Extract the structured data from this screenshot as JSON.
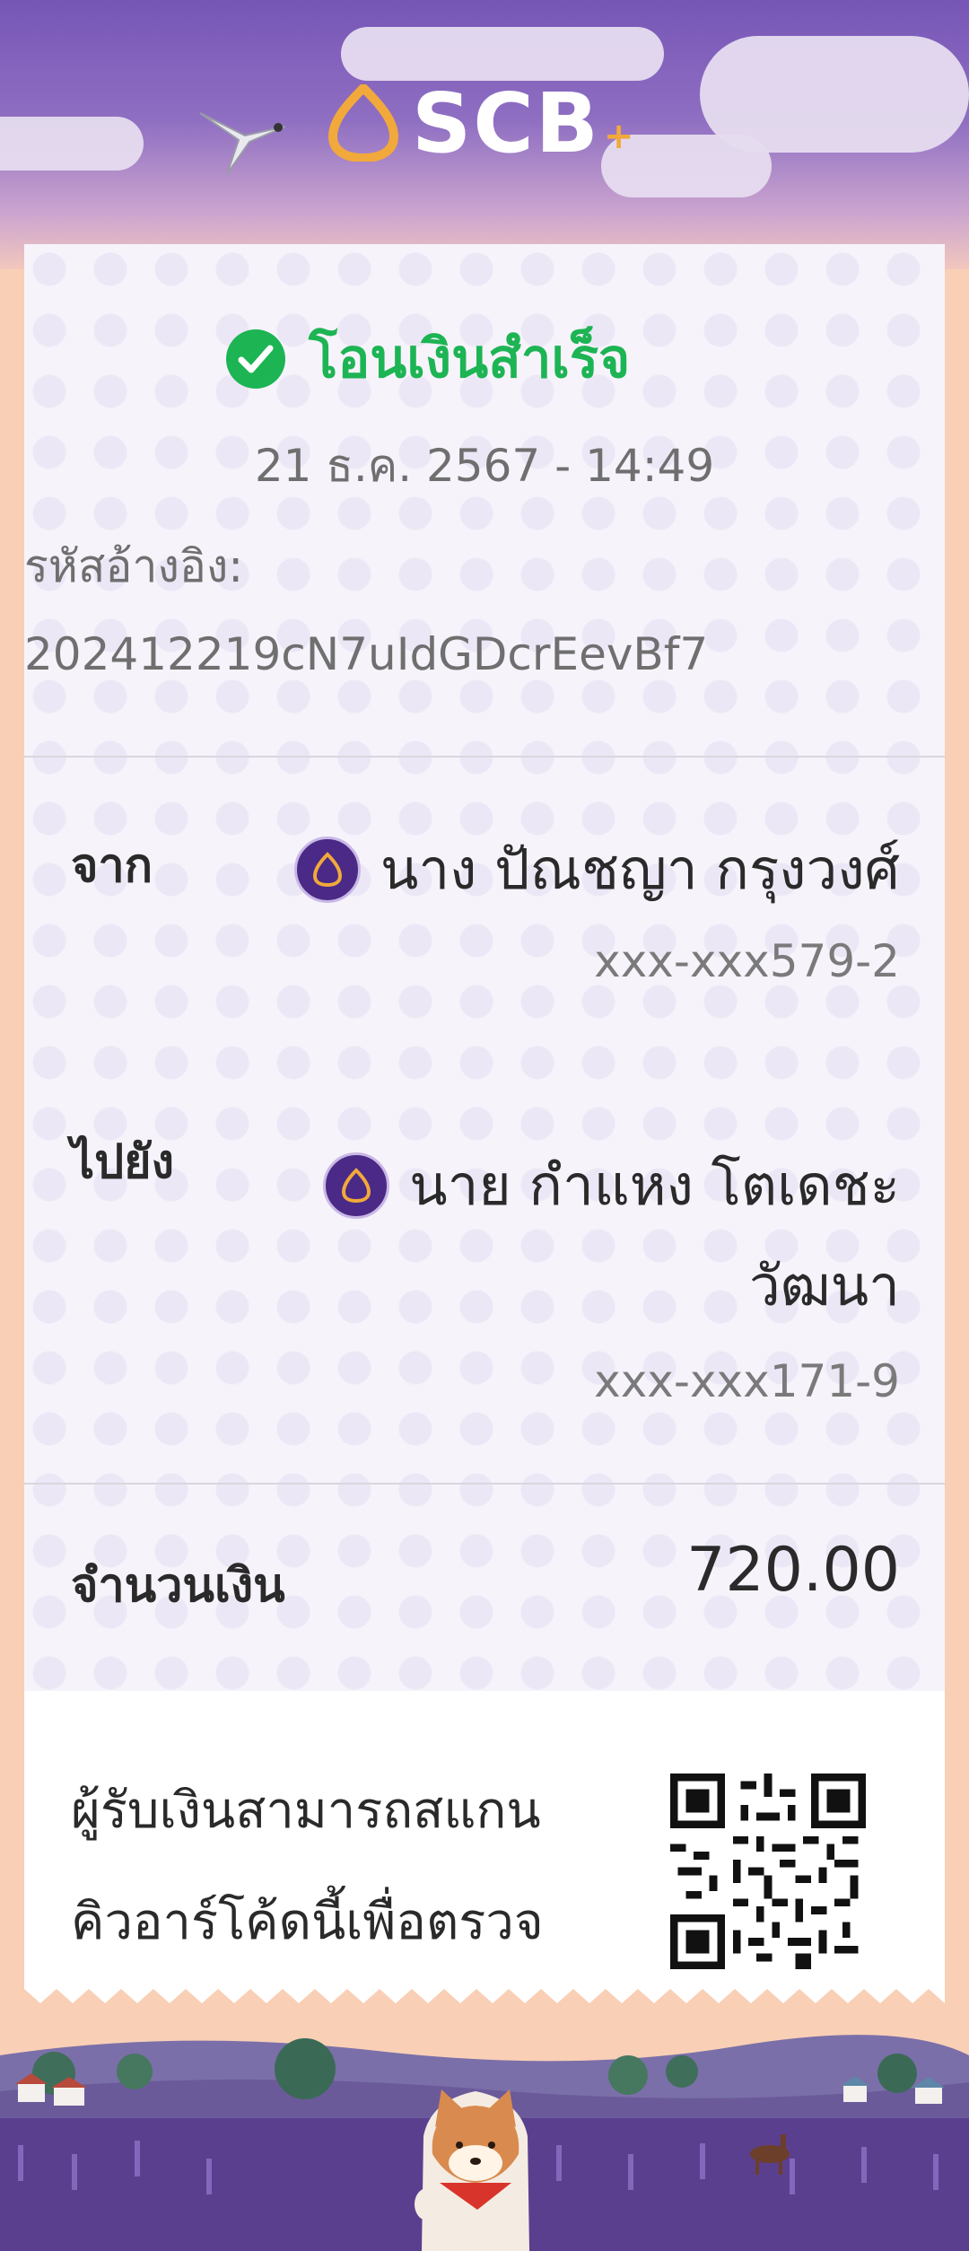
{
  "header": {
    "logo_text": "SCB",
    "logo_plus": "+"
  },
  "status": {
    "icon": "check-circle-icon",
    "text": "โอนเงินสำเร็จ",
    "color": "#1db454"
  },
  "transaction": {
    "datetime": "21 ธ.ค. 2567 - 14:49",
    "ref_label": "รหัสอ้างอิง:",
    "ref_value": "202412219cN7uIdGDcrEevBf7"
  },
  "from": {
    "label": "จาก",
    "name": "นาง ปัณชญา กรุงวงศ์",
    "account": "xxx-xxx579-2"
  },
  "to": {
    "label": "ไปยัง",
    "name_line1": "นาย กำแหง โตเดชะ",
    "name_line2": "วัฒนา",
    "account": "xxx-xxx171-9"
  },
  "amount": {
    "label": "จำนวนเงิน",
    "value": "720.00"
  },
  "qr_note": {
    "line1": "ผู้รับเงินสามารถสแกน",
    "line2": "คิวอาร์โค้ดนี้เพื่อตรวจ"
  },
  "colors": {
    "brand_purple": "#4a2a86",
    "brand_gold": "#f2a93b",
    "success_green": "#1db454"
  }
}
